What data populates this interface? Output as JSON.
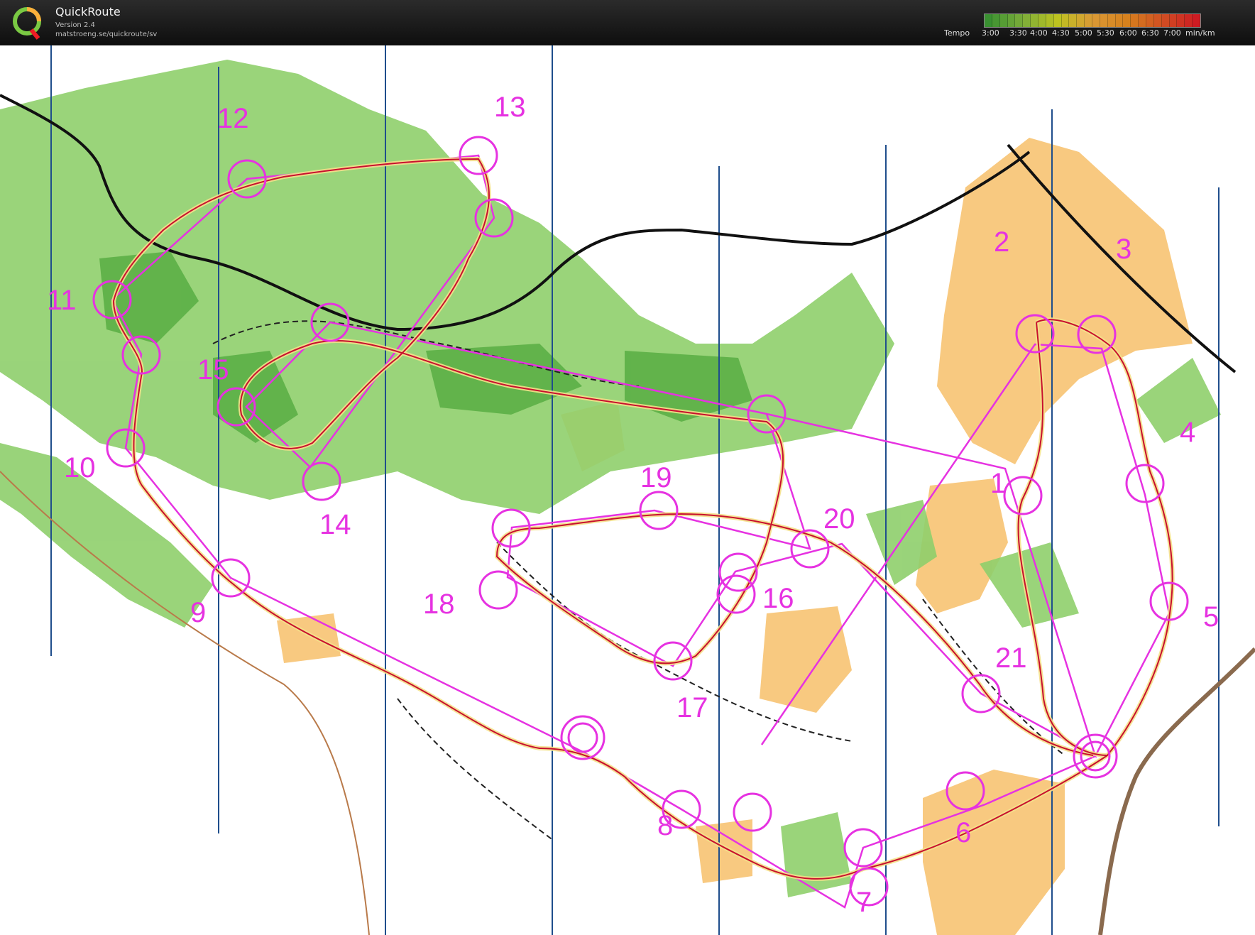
{
  "app": {
    "title": "QuickRoute",
    "version": "Version 2.4",
    "url": "matstroeng.se/quickroute/sv",
    "logo_letter": "Q"
  },
  "legend": {
    "label": "Tempo",
    "ticks": [
      "3:00",
      "3:30",
      "4:00",
      "4:30",
      "5:00",
      "5:30",
      "6:00",
      "6:30",
      "7:00"
    ],
    "unit": "min/km",
    "gradient_colors": [
      "#3fa535",
      "#8cc63f",
      "#d9e021",
      "#fbb03b",
      "#f7931e",
      "#f15a24",
      "#ed1c24"
    ]
  },
  "map": {
    "control_color": "#e632e1",
    "route_color": "#c8102e",
    "meridian_color": "#1f4e8c",
    "forest_color": "#7cc35a",
    "open_land_color": "#f7b24d",
    "controls": [
      "1",
      "2",
      "3",
      "4",
      "5",
      "6",
      "7",
      "8",
      "9",
      "10",
      "11",
      "12",
      "13",
      "14",
      "15",
      "16",
      "17",
      "18",
      "19",
      "20",
      "21"
    ]
  }
}
